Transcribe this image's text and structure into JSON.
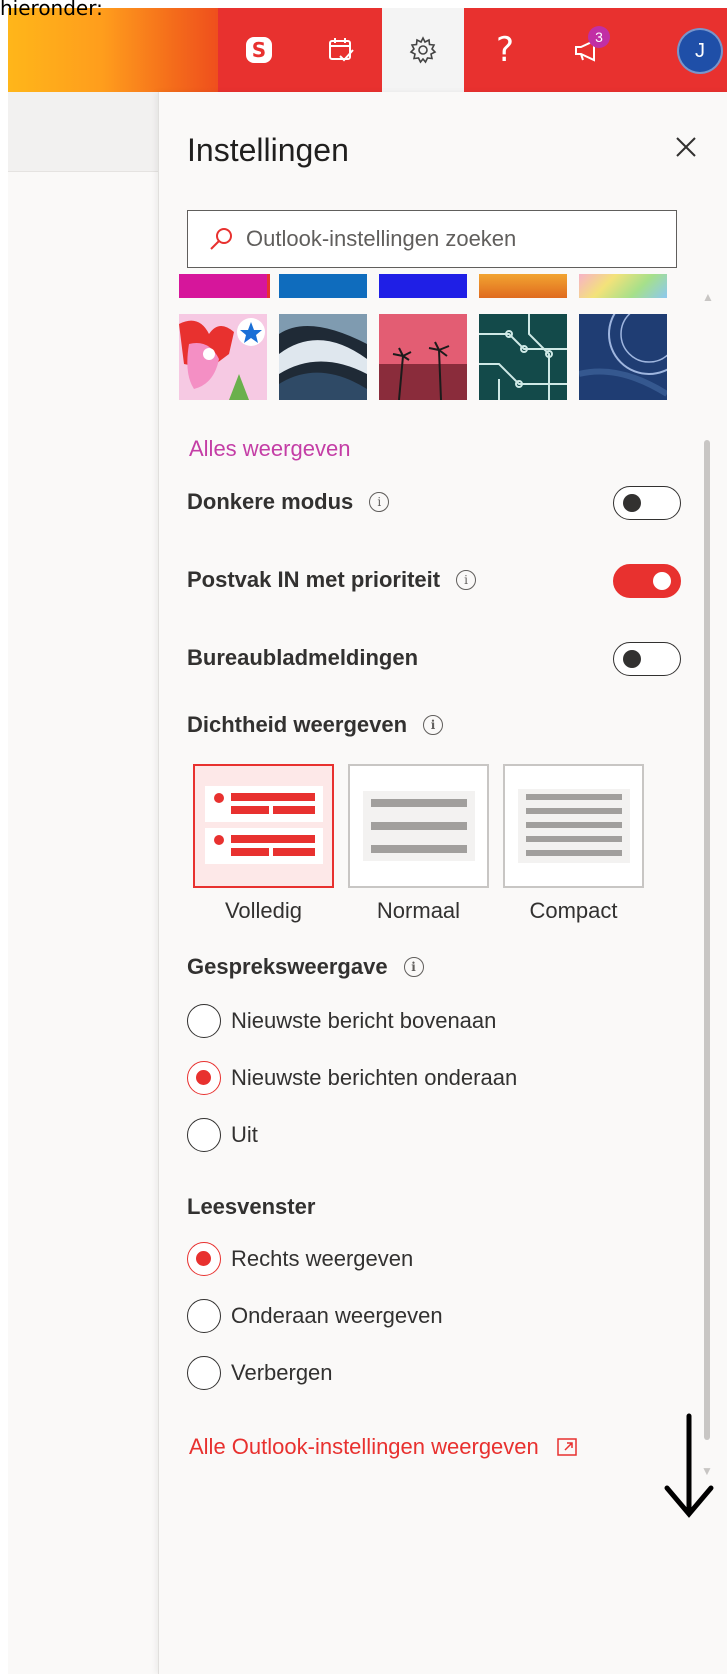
{
  "caption": "hieronder:",
  "topbar": {
    "skype_icon": "skype-icon",
    "tasks_icon": "calendar-check-icon",
    "settings_icon": "gear-icon",
    "help_label": "?",
    "megaphone_icon": "megaphone-icon",
    "notification_count": "3",
    "avatar_initial": "J",
    "colors": {
      "accent": "#e8312f",
      "gradient_start": "#ffb61a",
      "avatar": "#1f4fa8",
      "badge": "#c12fa5"
    }
  },
  "panel": {
    "title": "Instellingen",
    "close_icon": "close-icon",
    "search": {
      "placeholder": "Outlook-instellingen zoeken",
      "value": ""
    },
    "theme_swatches": [
      "#d6169b",
      "#0f6cbd",
      "#1f1fe6",
      "orange-gradient",
      "rainbow-gradient"
    ],
    "theme_images": [
      "cartoon-theme",
      "wave-landscape-theme",
      "palm-sunset-theme",
      "circuit-board-theme",
      "blue-stamp-theme"
    ],
    "show_all_label": "Alles weergeven",
    "toggles": [
      {
        "label": "Donkere modus",
        "on": false,
        "has_info": true
      },
      {
        "label": "Postvak IN met prioriteit",
        "on": true,
        "has_info": true
      },
      {
        "label": "Bureaubladmeldingen",
        "on": false,
        "has_info": false
      }
    ],
    "density": {
      "label": "Dichtheid weergeven",
      "options": [
        "Volledig",
        "Normaal",
        "Compact"
      ],
      "selected": "Volledig"
    },
    "conversation_view": {
      "label": "Gespreksweergave",
      "options": [
        "Nieuwste bericht bovenaan",
        "Nieuwste berichten onderaan",
        "Uit"
      ],
      "selected": "Nieuwste berichten onderaan"
    },
    "reading_pane": {
      "label": "Leesvenster",
      "options": [
        "Rechts weergeven",
        "Onderaan weergeven",
        "Verbergen"
      ],
      "selected": "Rechts weergeven"
    },
    "all_settings_link": "Alle Outlook-instellingen weergeven"
  }
}
